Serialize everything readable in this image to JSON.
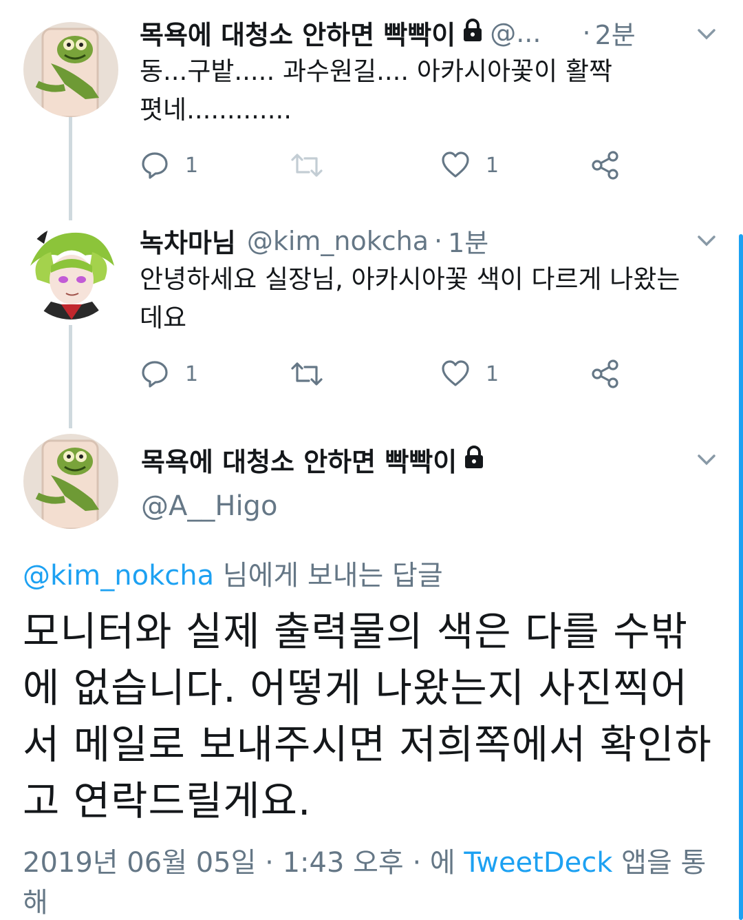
{
  "tweets": [
    {
      "name": "목욕에 대청소 안하면 빡빡이",
      "handle": "@...",
      "time": "2분",
      "text": "동...구밭..... 과수원길.... 아카시아꽃이 활짝폇네.............",
      "replies": "1",
      "likes": "1"
    },
    {
      "name": "녹차마님",
      "handle": "@kim_nokcha",
      "time": "1분",
      "text": "안녕하세요 실장님, 아카시아꽃 색이 다르게 나왔는데요",
      "replies": "1",
      "likes": "1"
    }
  ],
  "main_tweet": {
    "name": "목욕에 대청소 안하면 빡빡이",
    "handle": "@A__Higo",
    "reply_mention": "@kim_nokcha",
    "reply_suffix": " 님에게 보내는 답글",
    "text": "모니터와 실제 출력물의 색은 다를 수밖에 없습니다. 어떻게 나왔는지 사진찍어서 메일로 보내주시면 저희쪽에서 확인하고 연락드릴게요.",
    "date": "2019년 06월 05일",
    "time": "1:43 오후",
    "via_prefix": "에",
    "app": "TweetDeck",
    "via_suffix": "앱을 통해"
  },
  "icons": {
    "reply": "reply-icon",
    "retweet": "retweet-icon",
    "like": "heart-icon",
    "share": "share-icon",
    "lock": "lock-icon",
    "menu": "chevron-down-icon"
  },
  "colors": {
    "text": "#14171a",
    "secondary": "#657786",
    "accent": "#1da1f2",
    "thread_line": "#cfd9de"
  }
}
